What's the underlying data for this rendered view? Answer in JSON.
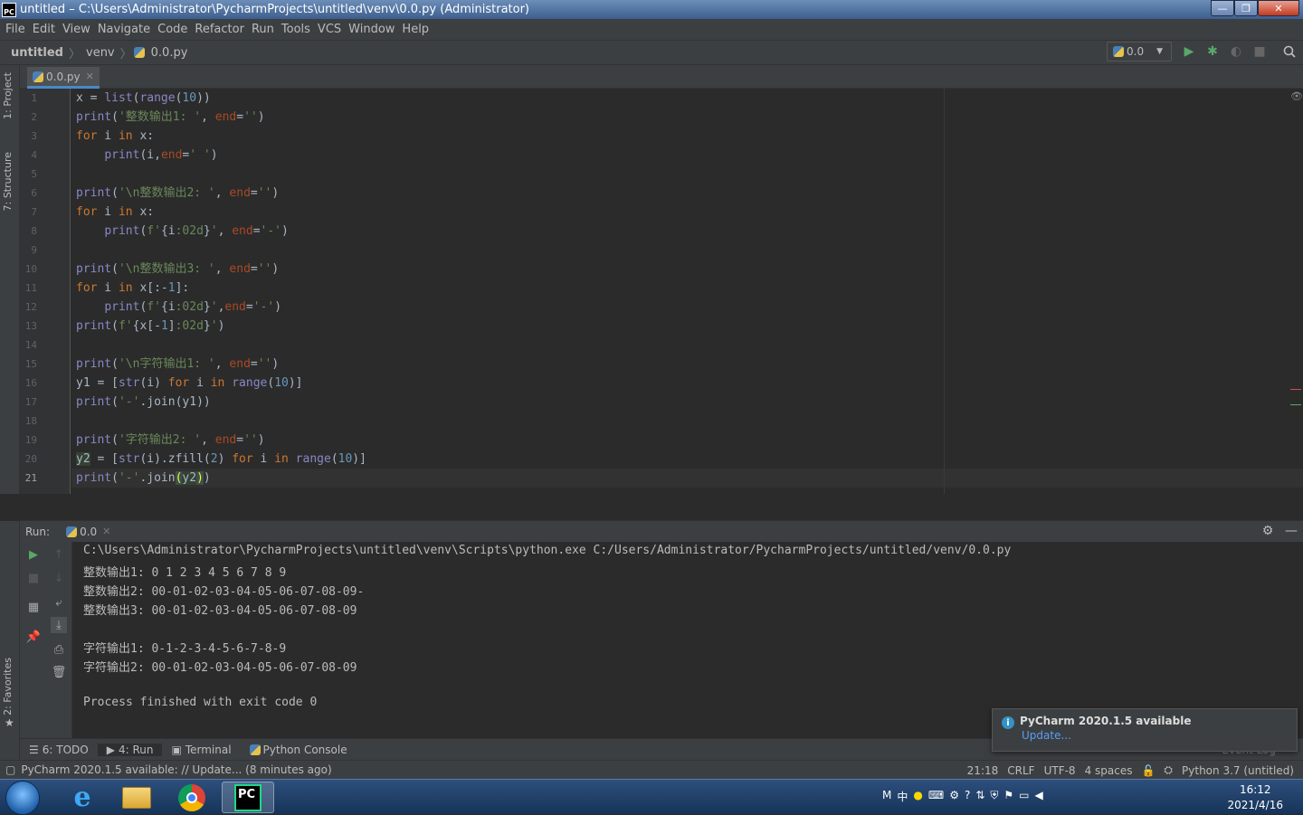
{
  "window": {
    "title": "untitled – C:\\Users\\Administrator\\PycharmProjects\\untitled\\venv\\0.0.py (Administrator)",
    "app_icon": "PC",
    "minimize": "—",
    "maximize": "❐",
    "close": "✕"
  },
  "menu": [
    "File",
    "Edit",
    "View",
    "Navigate",
    "Code",
    "Refactor",
    "Run",
    "Tools",
    "VCS",
    "Window",
    "Help"
  ],
  "breadcrumb": {
    "project": "untitled",
    "folder": "venv",
    "file": "0.0.py"
  },
  "run_config": {
    "label": "0.0"
  },
  "left_tabs": {
    "project": "1: Project",
    "structure": "7: Structure",
    "favorites": "2: Favorites"
  },
  "editor_tab": {
    "label": "0.0.py"
  },
  "line_numbers": [
    "1",
    "2",
    "3",
    "4",
    "5",
    "6",
    "7",
    "8",
    "9",
    "10",
    "11",
    "12",
    "13",
    "14",
    "15",
    "16",
    "17",
    "18",
    "19",
    "20",
    "21"
  ],
  "run_panel": {
    "header": "Run:",
    "tab": "0.0"
  },
  "console": [
    "C:\\Users\\Administrator\\PycharmProjects\\untitled\\venv\\Scripts\\python.exe C:/Users/Administrator/PycharmProjects/untitled/venv/0.0.py",
    "整数输出1: 0 1 2 3 4 5 6 7 8 9",
    "整数输出2: 00-01-02-03-04-05-06-07-08-09-",
    "整数输出3: 00-01-02-03-04-05-06-07-08-09",
    "",
    "字符输出1: 0-1-2-3-4-5-6-7-8-9",
    "字符输出2: 00-01-02-03-04-05-06-07-08-09",
    "",
    "Process finished with exit code 0"
  ],
  "bottom_tabs": [
    "6: TODO",
    "4: Run",
    "Terminal",
    "Python Console"
  ],
  "event_log": "Event Log",
  "status": {
    "message": "PyCharm 2020.1.5 available: // Update... (8 minutes ago)",
    "position": "21:18",
    "line_sep": "CRLF",
    "encoding": "UTF-8",
    "indent": "4 spaces",
    "interpreter": "Python 3.7 (untitled)"
  },
  "notification": {
    "title": "PyCharm 2020.1.5 available",
    "link": "Update..."
  },
  "taskbar": {
    "time": "16:12",
    "date": "2021/4/16",
    "ime": "中"
  }
}
